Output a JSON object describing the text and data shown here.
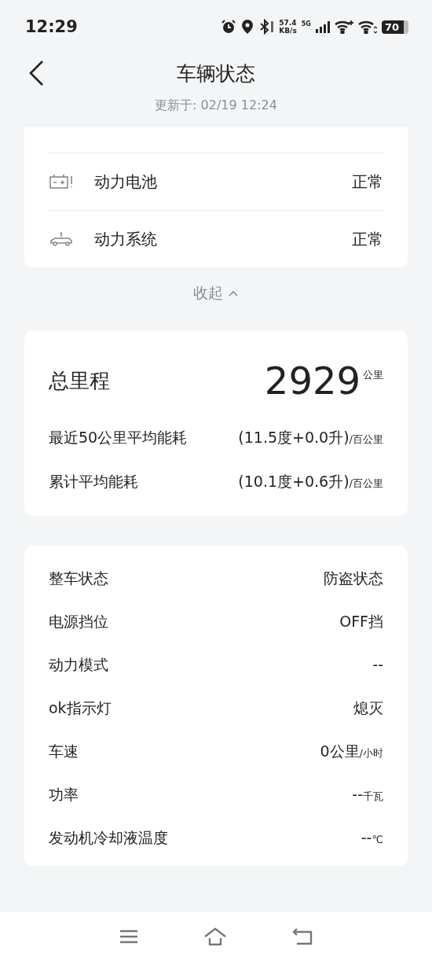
{
  "status_bar": {
    "time": "12:29",
    "speed_value": "57.4",
    "speed_unit": "KB/s",
    "network": "5G",
    "battery": "70"
  },
  "header": {
    "title": "车辆状态",
    "updated": "更新于: 02/19 12:24"
  },
  "systems": [
    {
      "kind": "battery",
      "label": "动力电池",
      "status": "正常"
    },
    {
      "kind": "car",
      "label": "动力系统",
      "status": "正常"
    }
  ],
  "collapse": {
    "label": "收起"
  },
  "mileage": {
    "title": "总里程",
    "value": "2929",
    "unit": "公里",
    "consumption": [
      {
        "label": "最近50公里平均能耗",
        "value": "(11.5度+0.0升)",
        "unit": "/百公里"
      },
      {
        "label": "累计平均能耗",
        "value": "(10.1度+0.6升)",
        "unit": "/百公里"
      }
    ]
  },
  "vehicle": [
    {
      "label": "整车状态",
      "value": "防盗状态"
    },
    {
      "label": "电源挡位",
      "value": "OFF挡"
    },
    {
      "label": "动力模式",
      "value": "--"
    },
    {
      "label": "ok指示灯",
      "value": "熄灭"
    },
    {
      "label": "车速",
      "value": "0公里",
      "unit": "/小时"
    },
    {
      "label": "功率",
      "value": "--",
      "unit": "千瓦"
    },
    {
      "label": "发动机冷却液温度",
      "value": "--",
      "unit": "℃"
    }
  ]
}
